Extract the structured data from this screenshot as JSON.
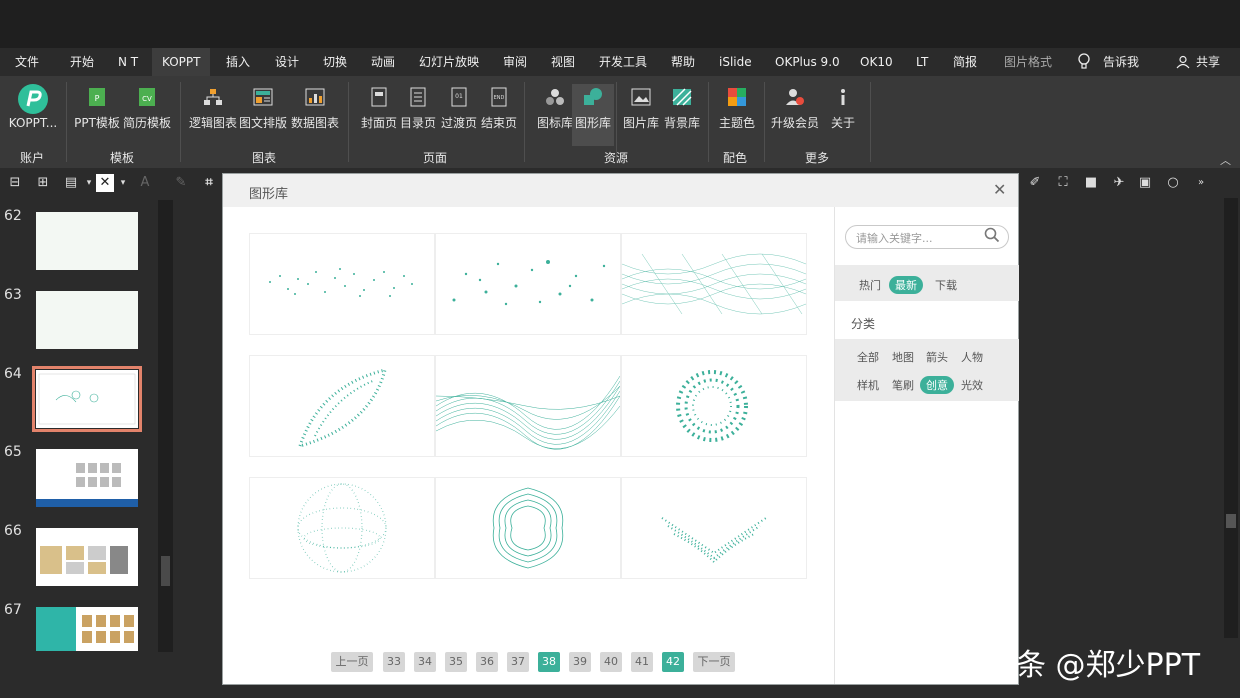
{
  "menu": {
    "items": [
      "文件",
      "开始",
      "N T",
      "KOPPT",
      "插入",
      "设计",
      "切换",
      "动画",
      "幻灯片放映",
      "审阅",
      "视图",
      "开发工具",
      "帮助",
      "iSlide",
      "OKPlus 9.0",
      "OK10",
      "LT",
      "简报",
      "图片格式"
    ],
    "active": "KOPPT",
    "tell_me": "告诉我",
    "share": "共享"
  },
  "ribbon": {
    "buttons": {
      "koppt": "KOPPT...",
      "ppt_template": "PPT模板",
      "resume_template": "简历模板",
      "logic_chart": "逻辑图表",
      "text_layout": "图文排版",
      "data_chart": "数据图表",
      "cover_page": "封面页",
      "toc_page": "目录页",
      "transition_page": "过渡页",
      "end_page": "结束页",
      "icon_library": "图标库",
      "shape_library": "图形库",
      "image_library": "图片库",
      "background_library": "背景库",
      "theme_color": "主题色",
      "upgrade_member": "升级会员",
      "about": "关于"
    },
    "groups": {
      "account": "账户",
      "template": "模板",
      "chart": "图表",
      "page": "页面",
      "resource": "资源",
      "color": "配色",
      "more": "更多"
    }
  },
  "thumbnails": {
    "numbers": [
      "62",
      "63",
      "64",
      "65",
      "66",
      "67"
    ],
    "selected": "64"
  },
  "dialog": {
    "title": "图形库",
    "search_placeholder": "请输入关键字...",
    "sort_tabs": [
      "热门",
      "最新",
      "下载"
    ],
    "sort_active": "最新",
    "category_title": "分类",
    "categories": [
      "全部",
      "地图",
      "箭头",
      "人物",
      "样机",
      "笔刷",
      "创意",
      "光效"
    ],
    "category_active": "创意",
    "pagination": {
      "prev": "上一页",
      "pages": [
        "33",
        "34",
        "35",
        "36",
        "37",
        "38",
        "39",
        "40",
        "41",
        "42"
      ],
      "current": "38",
      "highlight_last": "42",
      "next": "下一页"
    }
  },
  "watermark": "头条 @郑少PPT",
  "colors": {
    "accent": "#3cb09a",
    "thumb_selected": "#e3836b"
  }
}
